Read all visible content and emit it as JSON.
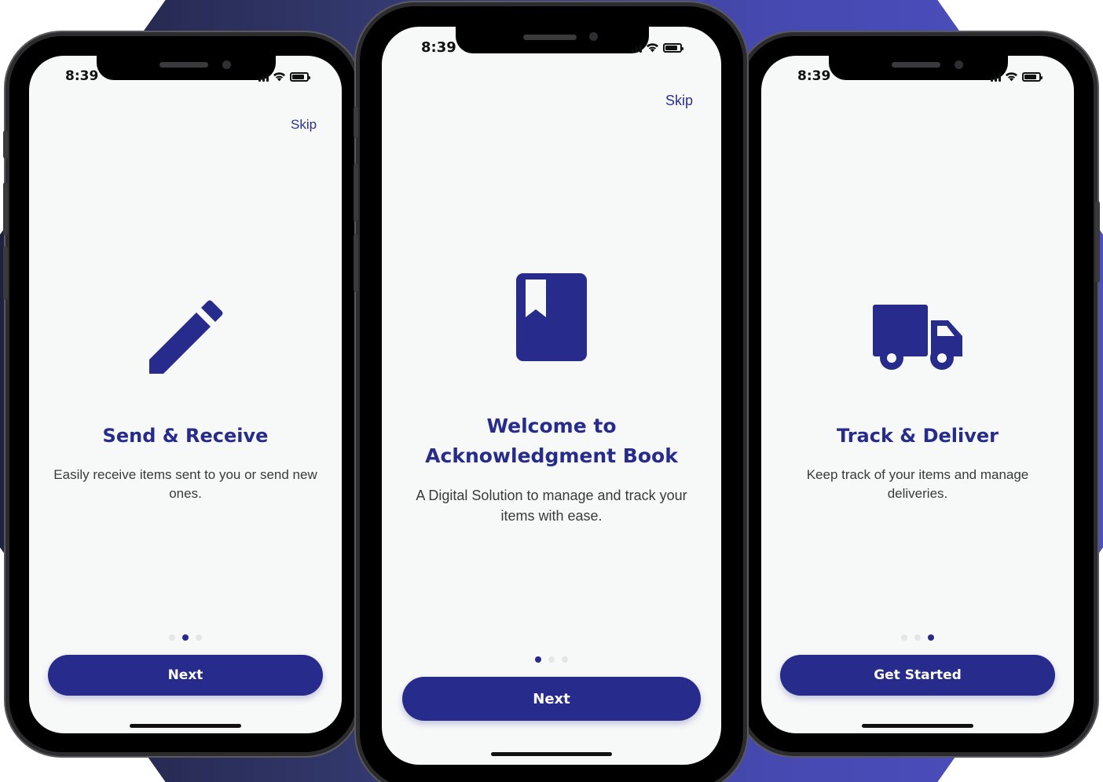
{
  "colors": {
    "accent": "#262b8c",
    "screen_bg": "#f7f8f8",
    "dot_inactive": "#e6e6e8",
    "backdrop_start": "#1f2140",
    "backdrop_end": "#4d4fc0"
  },
  "phones": {
    "left": {
      "status_time": "8:39",
      "skip_label": "Skip",
      "icon": "pencil-icon",
      "title": "Send & Receive",
      "description": "Easily receive items sent to you or send new ones.",
      "page_index": 2,
      "page_count": 3,
      "cta_label": "Next"
    },
    "center": {
      "status_time": "8:39",
      "skip_label": "Skip",
      "icon": "bookmark-book-icon",
      "title_line1": "Welcome to",
      "title_line2": "Acknowledgment Book",
      "description": "A Digital Solution to manage and track your items with ease.",
      "page_index": 1,
      "page_count": 3,
      "cta_label": "Next"
    },
    "right": {
      "status_time": "8:39",
      "skip_label": "",
      "icon": "truck-icon",
      "title": "Track & Deliver",
      "description": "Keep track of your items and manage deliveries.",
      "page_index": 3,
      "page_count": 3,
      "cta_label": "Get Started"
    }
  }
}
